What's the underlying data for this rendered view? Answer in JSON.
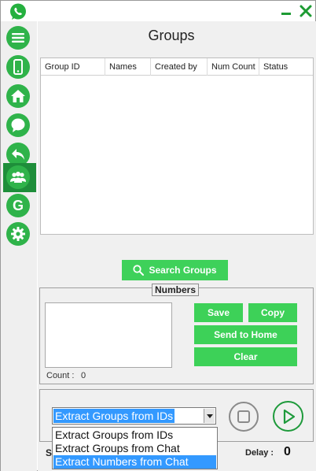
{
  "window": {
    "min_symbol": "‒",
    "close_symbol": "✕"
  },
  "sidebar": {
    "items": [
      {
        "icon": "menu-icon"
      },
      {
        "icon": "phone-icon"
      },
      {
        "icon": "home-icon"
      },
      {
        "icon": "chat-icon"
      },
      {
        "icon": "back-arrow-icon"
      },
      {
        "icon": "groups-icon",
        "active": true
      },
      {
        "icon": "g-letter-icon",
        "glyph": "G"
      },
      {
        "icon": "settings-icon"
      }
    ]
  },
  "page": {
    "title": "Groups"
  },
  "groups_table": {
    "columns": [
      "Group ID",
      "Names",
      "Created by",
      "Num Count",
      "Status"
    ],
    "rows": []
  },
  "search_button": {
    "label": "Search Groups"
  },
  "numbers": {
    "legend": "Numbers",
    "text": "",
    "count_label": "Count :",
    "count_value": "0",
    "save_label": "Save",
    "copy_label": "Copy",
    "send_label": "Send to Home",
    "clear_label": "Clear"
  },
  "mode_select": {
    "value": "Extract Groups from IDs",
    "options": [
      "Extract Groups from IDs",
      "Extract Groups from Chat",
      "Extract Numbers from Chat"
    ],
    "highlighted_option": "Extract Numbers from Chat"
  },
  "footer": {
    "status_label": "S",
    "delay_label": "Delay :",
    "delay_value": "0"
  },
  "colors": {
    "accent_green": "#2fb34a",
    "button_green": "#3dd158",
    "selection_blue": "#3399ff"
  }
}
